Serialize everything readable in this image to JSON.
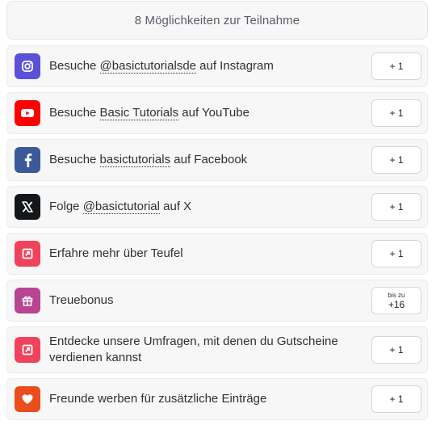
{
  "header": {
    "title": "8 Möglichkeiten zur Teilnahme"
  },
  "entries": [
    {
      "prefix": "Besuche ",
      "link": "@basictutorialsde",
      "suffix": " auf Instagram",
      "button": "+ 1",
      "icon": "instagram-icon",
      "color": "#5b51d8"
    },
    {
      "prefix": "Besuche ",
      "link": "Basic Tutorials",
      "suffix": " auf YouTube",
      "button": "+ 1",
      "icon": "youtube-icon",
      "color": "#ff0000"
    },
    {
      "prefix": "Besuche ",
      "link": "basictutorials",
      "suffix": " auf Facebook",
      "button": "+ 1",
      "icon": "facebook-icon",
      "color": "#3b5998"
    },
    {
      "prefix": "Folge ",
      "link": "@basictutorial",
      "suffix": " auf X",
      "button": "+ 1",
      "icon": "x-icon",
      "color": "#14171a"
    },
    {
      "text": "Erfahre mehr über Teufel",
      "button": "+ 1",
      "icon": "external-link-icon",
      "color": "#f0425a"
    },
    {
      "text": "Treuebonus",
      "button_small": "bis zu",
      "button": "+16",
      "icon": "gift-icon",
      "color": "#b84592"
    },
    {
      "text": "Entdecke unsere Umfragen, mit denen du Gutscheine verdienen kannst",
      "button": "+ 1",
      "icon": "external-link-icon",
      "color": "#f0425a"
    },
    {
      "text": "Freunde werben für zusätzliche Einträge",
      "button": "+ 1",
      "icon": "heart-icon",
      "color": "#ea4e1d"
    }
  ]
}
